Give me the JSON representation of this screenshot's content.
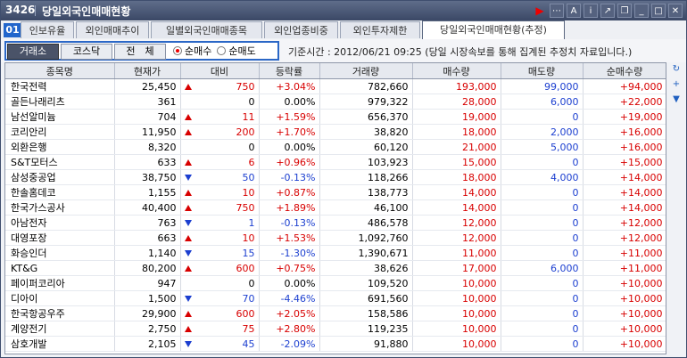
{
  "window": {
    "code": "3426",
    "title": "당일외국인매매현황"
  },
  "tabs": [
    {
      "label": "인보유율",
      "left": 0,
      "width": 0
    },
    {
      "label": "외인매매추이"
    },
    {
      "label": "일별외국인매매종목"
    },
    {
      "label": "외인업종비중"
    },
    {
      "label": "외인투자제한"
    },
    {
      "label": "당일외국인매매현황(추정)"
    }
  ],
  "tab_number": "01",
  "market_buttons": [
    "거래소",
    "코스닥",
    "전　체"
  ],
  "radio": {
    "buy": "순매수",
    "sell": "순매도"
  },
  "info_text": "기준시간 : 2012/06/21 09:25   (당일 시장속보를 통해 집계된 추정치 자료입니다.)",
  "columns": [
    "종목명",
    "현재가",
    "대비",
    "등락률",
    "거래량",
    "매수량",
    "매도량",
    "순매수량"
  ],
  "rows": [
    {
      "name": "한국전력",
      "price": "25,450",
      "dir": "up",
      "diff": "750",
      "rate": "+3.04%",
      "vol": "782,660",
      "buy": "193,000",
      "sell": "99,000",
      "net": "+94,000"
    },
    {
      "name": "골든나래리츠",
      "price": "361",
      "dir": "",
      "diff": "0",
      "rate": "0.00%",
      "vol": "979,322",
      "buy": "28,000",
      "sell": "6,000",
      "net": "+22,000"
    },
    {
      "name": "남선알미늄",
      "price": "704",
      "dir": "up",
      "diff": "11",
      "rate": "+1.59%",
      "vol": "656,370",
      "buy": "19,000",
      "sell": "0",
      "net": "+19,000"
    },
    {
      "name": "코리안리",
      "price": "11,950",
      "dir": "up",
      "diff": "200",
      "rate": "+1.70%",
      "vol": "38,820",
      "buy": "18,000",
      "sell": "2,000",
      "net": "+16,000"
    },
    {
      "name": "외환은행",
      "price": "8,320",
      "dir": "",
      "diff": "0",
      "rate": "0.00%",
      "vol": "60,120",
      "buy": "21,000",
      "sell": "5,000",
      "net": "+16,000"
    },
    {
      "name": "S&T모터스",
      "price": "633",
      "dir": "up",
      "diff": "6",
      "rate": "+0.96%",
      "vol": "103,923",
      "buy": "15,000",
      "sell": "0",
      "net": "+15,000"
    },
    {
      "name": "삼성중공업",
      "price": "38,750",
      "dir": "dn",
      "diff": "50",
      "rate": "-0.13%",
      "vol": "118,266",
      "buy": "18,000",
      "sell": "4,000",
      "net": "+14,000"
    },
    {
      "name": "한솔홈데코",
      "price": "1,155",
      "dir": "up",
      "diff": "10",
      "rate": "+0.87%",
      "vol": "138,773",
      "buy": "14,000",
      "sell": "0",
      "net": "+14,000"
    },
    {
      "name": "한국가스공사",
      "price": "40,400",
      "dir": "up",
      "diff": "750",
      "rate": "+1.89%",
      "vol": "46,100",
      "buy": "14,000",
      "sell": "0",
      "net": "+14,000"
    },
    {
      "name": "아남전자",
      "price": "763",
      "dir": "dn",
      "diff": "1",
      "rate": "-0.13%",
      "vol": "486,578",
      "buy": "12,000",
      "sell": "0",
      "net": "+12,000"
    },
    {
      "name": "대영포장",
      "price": "663",
      "dir": "up",
      "diff": "10",
      "rate": "+1.53%",
      "vol": "1,092,760",
      "buy": "12,000",
      "sell": "0",
      "net": "+12,000"
    },
    {
      "name": "화승인더",
      "price": "1,140",
      "dir": "dn",
      "diff": "15",
      "rate": "-1.30%",
      "vol": "1,390,671",
      "buy": "11,000",
      "sell": "0",
      "net": "+11,000"
    },
    {
      "name": "KT&G",
      "price": "80,200",
      "dir": "up",
      "diff": "600",
      "rate": "+0.75%",
      "vol": "38,626",
      "buy": "17,000",
      "sell": "6,000",
      "net": "+11,000"
    },
    {
      "name": "페이퍼코리아",
      "price": "947",
      "dir": "",
      "diff": "0",
      "rate": "0.00%",
      "vol": "109,520",
      "buy": "10,000",
      "sell": "0",
      "net": "+10,000"
    },
    {
      "name": "디아이",
      "price": "1,500",
      "dir": "dn",
      "diff": "70",
      "rate": "-4.46%",
      "vol": "691,560",
      "buy": "10,000",
      "sell": "0",
      "net": "+10,000"
    },
    {
      "name": "한국항공우주",
      "price": "29,900",
      "dir": "up",
      "diff": "600",
      "rate": "+2.05%",
      "vol": "158,586",
      "buy": "10,000",
      "sell": "0",
      "net": "+10,000"
    },
    {
      "name": "계양전기",
      "price": "2,750",
      "dir": "up",
      "diff": "75",
      "rate": "+2.80%",
      "vol": "119,235",
      "buy": "10,000",
      "sell": "0",
      "net": "+10,000"
    },
    {
      "name": "삼호개발",
      "price": "2,105",
      "dir": "dn",
      "diff": "45",
      "rate": "-2.09%",
      "vol": "91,880",
      "buy": "10,000",
      "sell": "0",
      "net": "+10,000"
    }
  ],
  "colors": {
    "up": "#d80000",
    "down": "#1c3fd0",
    "accent": "#2b67c6"
  }
}
